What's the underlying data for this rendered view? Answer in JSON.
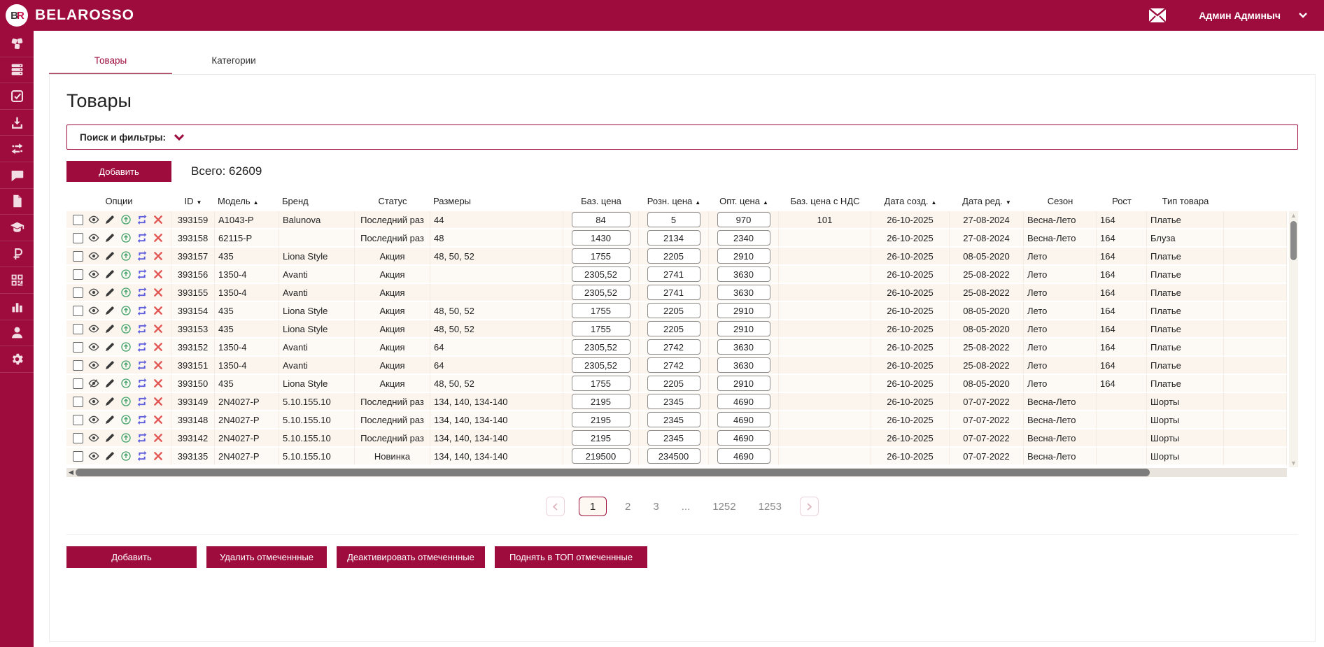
{
  "colors": {
    "accent": "#9e0c3d",
    "row_bg": "#fbf5ee",
    "row_alt_bg": "#fdf9f4",
    "tab_underline": "#b2556e"
  },
  "header": {
    "brand": "BELAROSSO",
    "logo_text_b": "B",
    "logo_text_r": "R",
    "user_name": "Админ Админыч"
  },
  "sidebar": {
    "icons": [
      "cubes",
      "database",
      "check-square",
      "download",
      "transfer-arrows",
      "comment",
      "document",
      "graduation-cap",
      "ruble",
      "qr-code",
      "bar-chart",
      "user",
      "gear"
    ]
  },
  "tabs": [
    {
      "label": "Товары",
      "active": true
    },
    {
      "label": "Категории",
      "active": false
    }
  ],
  "page": {
    "title": "Товары",
    "filters_label": "Поиск и фильтры:",
    "add_button_label": "Добавить",
    "total_label": "Всего: 62609"
  },
  "table": {
    "columns": [
      {
        "key": "opts",
        "label": "Опции",
        "sort": null,
        "align": "center"
      },
      {
        "key": "id",
        "label": "ID",
        "sort": "desc",
        "align": "center"
      },
      {
        "key": "model",
        "label": "Модель",
        "sort": "asc",
        "align": "left"
      },
      {
        "key": "brand",
        "label": "Бренд",
        "sort": null,
        "align": "left"
      },
      {
        "key": "status",
        "label": "Статус",
        "sort": null,
        "align": "center"
      },
      {
        "key": "sizes",
        "label": "Размеры",
        "sort": null,
        "align": "left"
      },
      {
        "key": "base_price",
        "label": "Баз. цена",
        "sort": null,
        "align": "center"
      },
      {
        "key": "retail_price",
        "label": "Розн. цена",
        "sort": "asc",
        "align": "center"
      },
      {
        "key": "wholesale_price",
        "label": "Опт. цена",
        "sort": "asc",
        "align": "center"
      },
      {
        "key": "base_price_vat",
        "label": "Баз. цена с НДС",
        "sort": null,
        "align": "center"
      },
      {
        "key": "created",
        "label": "Дата созд.",
        "sort": "asc",
        "align": "center"
      },
      {
        "key": "edited",
        "label": "Дата ред.",
        "sort": "desc",
        "align": "center"
      },
      {
        "key": "season",
        "label": "Сезон",
        "sort": null,
        "align": "center"
      },
      {
        "key": "height",
        "label": "Рост",
        "sort": null,
        "align": "center"
      },
      {
        "key": "type",
        "label": "Тип товара",
        "sort": null,
        "align": "center"
      }
    ],
    "rows": [
      {
        "id": "393159",
        "model": "A1043-P",
        "brand": "Balunova",
        "status": "Последний раз",
        "sizes": "44",
        "base_price": "84",
        "retail_price": "5",
        "wholesale_price": "970",
        "base_price_vat": "101",
        "created": "26-10-2025",
        "edited": "27-08-2024",
        "season": "Весна-Лето",
        "height": "164",
        "type": "Платье",
        "hidden": false
      },
      {
        "id": "393158",
        "model": "62115-P",
        "brand": "",
        "status": "Последний раз",
        "sizes": "48",
        "base_price": "1430",
        "retail_price": "2134",
        "wholesale_price": "2340",
        "base_price_vat": "",
        "created": "26-10-2025",
        "edited": "27-08-2024",
        "season": "Весна-Лето",
        "height": "164",
        "type": "Блуза",
        "hidden": false
      },
      {
        "id": "393157",
        "model": "435",
        "brand": "Liona Style",
        "status": "Акция",
        "sizes": "48, 50, 52",
        "base_price": "1755",
        "retail_price": "2205",
        "wholesale_price": "2910",
        "base_price_vat": "",
        "created": "26-10-2025",
        "edited": "08-05-2020",
        "season": "Лето",
        "height": "164",
        "type": "Платье",
        "hidden": false
      },
      {
        "id": "393156",
        "model": "1350-4",
        "brand": "Avanti",
        "status": "Акция",
        "sizes": "",
        "base_price": "2305,52",
        "retail_price": "2741",
        "wholesale_price": "3630",
        "base_price_vat": "",
        "created": "26-10-2025",
        "edited": "25-08-2022",
        "season": "Лето",
        "height": "164",
        "type": "Платье",
        "hidden": false
      },
      {
        "id": "393155",
        "model": "1350-4",
        "brand": "Avanti",
        "status": "Акция",
        "sizes": "",
        "base_price": "2305,52",
        "retail_price": "2741",
        "wholesale_price": "3630",
        "base_price_vat": "",
        "created": "26-10-2025",
        "edited": "25-08-2022",
        "season": "Лето",
        "height": "164",
        "type": "Платье",
        "hidden": false
      },
      {
        "id": "393154",
        "model": "435",
        "brand": "Liona Style",
        "status": "Акция",
        "sizes": "48, 50, 52",
        "base_price": "1755",
        "retail_price": "2205",
        "wholesale_price": "2910",
        "base_price_vat": "",
        "created": "26-10-2025",
        "edited": "08-05-2020",
        "season": "Лето",
        "height": "164",
        "type": "Платье",
        "hidden": false
      },
      {
        "id": "393153",
        "model": "435",
        "brand": "Liona Style",
        "status": "Акция",
        "sizes": "48, 50, 52",
        "base_price": "1755",
        "retail_price": "2205",
        "wholesale_price": "2910",
        "base_price_vat": "",
        "created": "26-10-2025",
        "edited": "08-05-2020",
        "season": "Лето",
        "height": "164",
        "type": "Платье",
        "hidden": false
      },
      {
        "id": "393152",
        "model": "1350-4",
        "brand": "Avanti",
        "status": "Акция",
        "sizes": "64",
        "base_price": "2305,52",
        "retail_price": "2742",
        "wholesale_price": "3630",
        "base_price_vat": "",
        "created": "26-10-2025",
        "edited": "25-08-2022",
        "season": "Лето",
        "height": "164",
        "type": "Платье",
        "hidden": false
      },
      {
        "id": "393151",
        "model": "1350-4",
        "brand": "Avanti",
        "status": "Акция",
        "sizes": "64",
        "base_price": "2305,52",
        "retail_price": "2742",
        "wholesale_price": "3630",
        "base_price_vat": "",
        "created": "26-10-2025",
        "edited": "25-08-2022",
        "season": "Лето",
        "height": "164",
        "type": "Платье",
        "hidden": false
      },
      {
        "id": "393150",
        "model": "435",
        "brand": "Liona Style",
        "status": "Акция",
        "sizes": "48, 50, 52",
        "base_price": "1755",
        "retail_price": "2205",
        "wholesale_price": "2910",
        "base_price_vat": "",
        "created": "26-10-2025",
        "edited": "08-05-2020",
        "season": "Лето",
        "height": "164",
        "type": "Платье",
        "hidden": true
      },
      {
        "id": "393149",
        "model": "2N4027-P",
        "brand": "5.10.155.10",
        "status": "Последний раз",
        "sizes": "134, 140, 134-140",
        "base_price": "2195",
        "retail_price": "2345",
        "wholesale_price": "4690",
        "base_price_vat": "",
        "created": "26-10-2025",
        "edited": "07-07-2022",
        "season": "Весна-Лето",
        "height": "",
        "type": "Шорты",
        "hidden": false
      },
      {
        "id": "393148",
        "model": "2N4027-P",
        "brand": "5.10.155.10",
        "status": "Последний раз",
        "sizes": "134, 140, 134-140",
        "base_price": "2195",
        "retail_price": "2345",
        "wholesale_price": "4690",
        "base_price_vat": "",
        "created": "26-10-2025",
        "edited": "07-07-2022",
        "season": "Весна-Лето",
        "height": "",
        "type": "Шорты",
        "hidden": false
      },
      {
        "id": "393142",
        "model": "2N4027-P",
        "brand": "5.10.155.10",
        "status": "Последний раз",
        "sizes": "134, 140, 134-140",
        "base_price": "2195",
        "retail_price": "2345",
        "wholesale_price": "4690",
        "base_price_vat": "",
        "created": "26-10-2025",
        "edited": "07-07-2022",
        "season": "Весна-Лето",
        "height": "",
        "type": "Шорты",
        "hidden": false
      },
      {
        "id": "393135",
        "model": "2N4027-P",
        "brand": "5.10.155.10",
        "status": "Новинка",
        "sizes": "134, 140, 134-140",
        "base_price": "219500",
        "retail_price": "234500",
        "wholesale_price": "4690",
        "base_price_vat": "",
        "created": "26-10-2025",
        "edited": "07-07-2022",
        "season": "Весна-Лето",
        "height": "",
        "type": "Шорты",
        "hidden": false
      }
    ]
  },
  "pagination": {
    "pages": [
      "1",
      "2",
      "3",
      "...",
      "1252",
      "1253"
    ],
    "current": "1"
  },
  "bottom_buttons": [
    "Добавить",
    "Удалить отмеченнные",
    "Деактивировать отмеченнные",
    "Поднять в ТОП отмеченнные"
  ]
}
